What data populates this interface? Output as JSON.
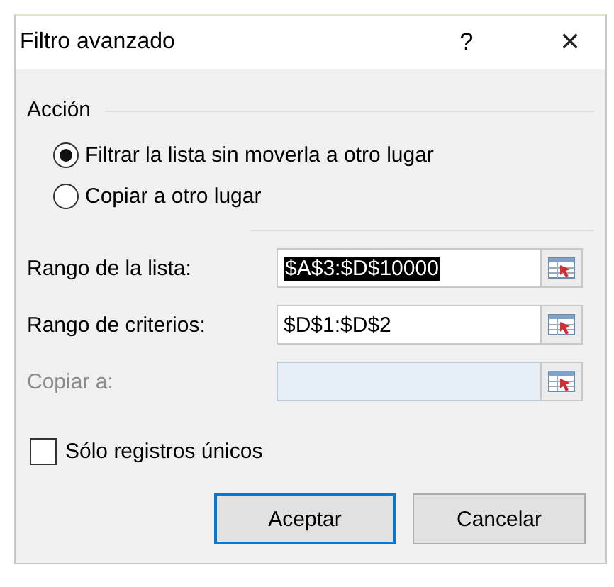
{
  "window": {
    "title": "Filtro avanzado",
    "help": "?",
    "close": "×"
  },
  "action": {
    "label": "Acción",
    "options": [
      {
        "label": "Filtrar la lista sin moverla a otro lugar",
        "selected": true
      },
      {
        "label": "Copiar a otro lugar",
        "selected": false
      }
    ]
  },
  "ranges": [
    {
      "label": "Rango de la lista:",
      "value": "$A$3:$D$10000",
      "text_selected": true,
      "disabled": false
    },
    {
      "label": "Rango de criterios:",
      "value": "$D$1:$D$2",
      "text_selected": false,
      "disabled": false
    },
    {
      "label": "Copiar a:",
      "disabled": true
    }
  ],
  "unique_only": {
    "label": "Sólo registros únicos",
    "checked": false
  },
  "buttons": [
    {
      "label": "Aceptar",
      "default": true
    },
    {
      "label": "Cancelar",
      "default": false
    }
  ]
}
